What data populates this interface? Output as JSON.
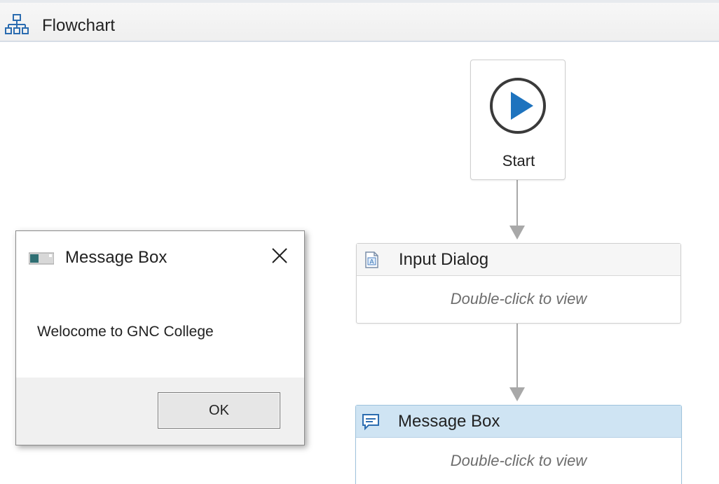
{
  "header": {
    "title": "Flowchart",
    "icon": "flowchart-icon"
  },
  "flowchart": {
    "start": {
      "label": "Start",
      "icon": "play-icon",
      "accent": "#1e73be"
    },
    "activities": [
      {
        "title": "Input Dialog",
        "hint": "Double-click to view",
        "icon": "input-dialog-icon",
        "selected": false
      },
      {
        "title": "Message Box",
        "hint": "Double-click to view",
        "icon": "message-box-icon",
        "selected": true,
        "header_color": "#cfe4f3"
      }
    ]
  },
  "message_dialog": {
    "title": "Message Box",
    "message": "Welocome to GNC College",
    "ok_label": "OK",
    "close_icon": "close-icon",
    "app_icon": "app-window-icon"
  }
}
